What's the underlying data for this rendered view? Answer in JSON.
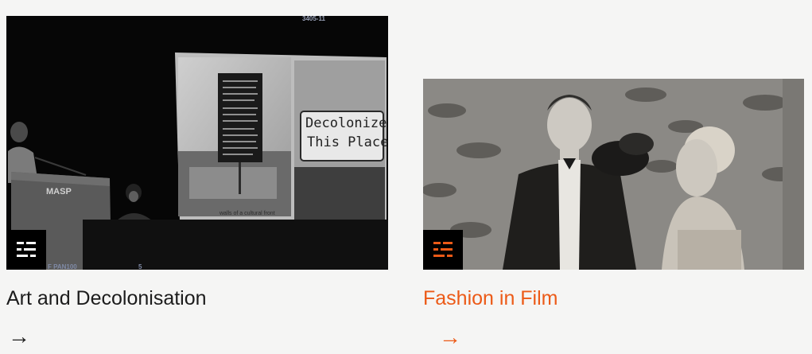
{
  "cards": [
    {
      "title": "Art and Decolonisation",
      "arrow": "→",
      "icon": "filter-list-icon",
      "icon_color": "#ffffff",
      "image": {
        "subject": "conference talk photo",
        "texts": {
          "top_code": "3405-11",
          "lectern": "MASP",
          "slide_heading_1": "Decolonize",
          "slide_heading_2": "This Place",
          "slide_caption": "walls of a cultural front",
          "bottom_left": "F PAN100",
          "bottom_mid": "5"
        }
      }
    },
    {
      "title": "Fashion in Film",
      "arrow": "→",
      "icon": "filter-list-icon",
      "icon_color": "#ec5a17",
      "image": {
        "subject": "vintage film still"
      }
    }
  ],
  "colors": {
    "background": "#f5f5f4",
    "accent": "#ec5a17",
    "text": "#1c1c1c"
  }
}
